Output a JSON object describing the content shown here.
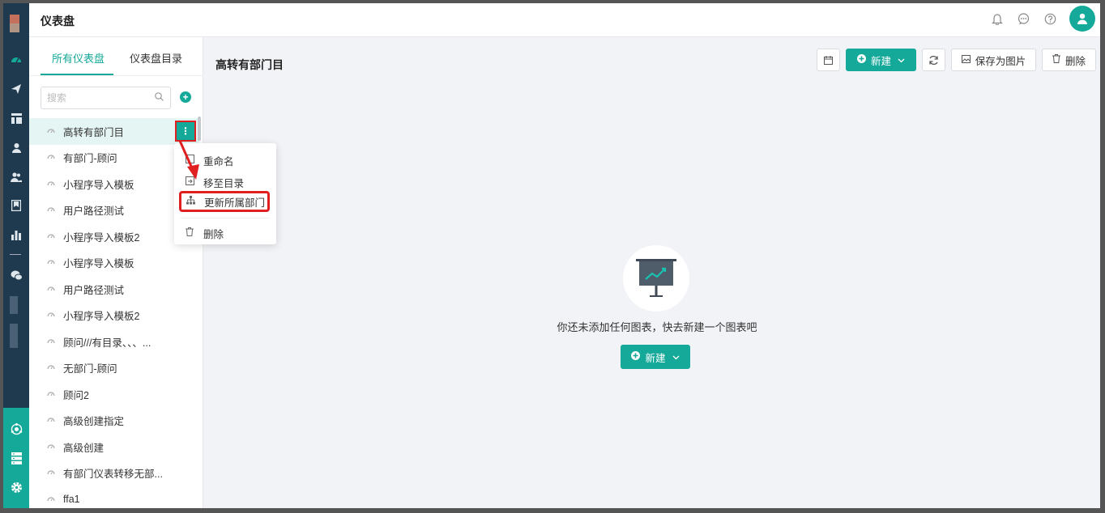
{
  "header": {
    "title": "仪表盘",
    "icons": [
      "bell-icon",
      "chat-icon",
      "help-icon",
      "user-avatar-icon"
    ]
  },
  "rail": {
    "icons": [
      "dashboard-icon",
      "send-icon",
      "layout-icon",
      "user-icon",
      "users-icon",
      "bookmark-icon",
      "bar-chart-icon",
      "wechat-icon"
    ],
    "bottom_icons": [
      "network-icon",
      "server-icon",
      "gear-icon"
    ]
  },
  "sidebar": {
    "tabs": [
      {
        "label": "所有仪表盘",
        "active": true
      },
      {
        "label": "仪表盘目录",
        "active": false
      }
    ],
    "search": {
      "placeholder": "搜索",
      "value": ""
    },
    "items": [
      {
        "label": "高转有部门目"
      },
      {
        "label": "有部门-顾问"
      },
      {
        "label": "小程序导入模板"
      },
      {
        "label": "用户路径测试"
      },
      {
        "label": "小程序导入模板2"
      },
      {
        "label": "小程序导入模板"
      },
      {
        "label": "用户路径测试"
      },
      {
        "label": "小程序导入模板2"
      },
      {
        "label": "顾问///有目录、、、..."
      },
      {
        "label": "无部门-顾问"
      },
      {
        "label": "顾问2"
      },
      {
        "label": "高级创建指定"
      },
      {
        "label": "高级创建"
      },
      {
        "label": "有部门仪表转移无部..."
      },
      {
        "label": "ffa1"
      }
    ],
    "more_glyph": "⋮"
  },
  "context_menu": {
    "items": [
      {
        "label": "重命名",
        "icon": "edit-icon"
      },
      {
        "label": "移至目录",
        "icon": "move-folder-icon"
      },
      {
        "label": "更新所属部门",
        "icon": "org-tree-icon",
        "highlighted": true
      },
      {
        "label": "删除",
        "icon": "trash-icon"
      }
    ]
  },
  "main": {
    "dashboard_title": "高转有部门目",
    "toolbar": {
      "new_label": "新建",
      "save_image_label": "保存为图片",
      "delete_label": "删除"
    },
    "empty_state": {
      "message": "你还未添加任何图表，快去新建一个图表吧",
      "button_label": "新建"
    }
  },
  "colors": {
    "accent": "#15a99a",
    "rail": "#1f3a4f",
    "annotation_red": "#e02020"
  }
}
